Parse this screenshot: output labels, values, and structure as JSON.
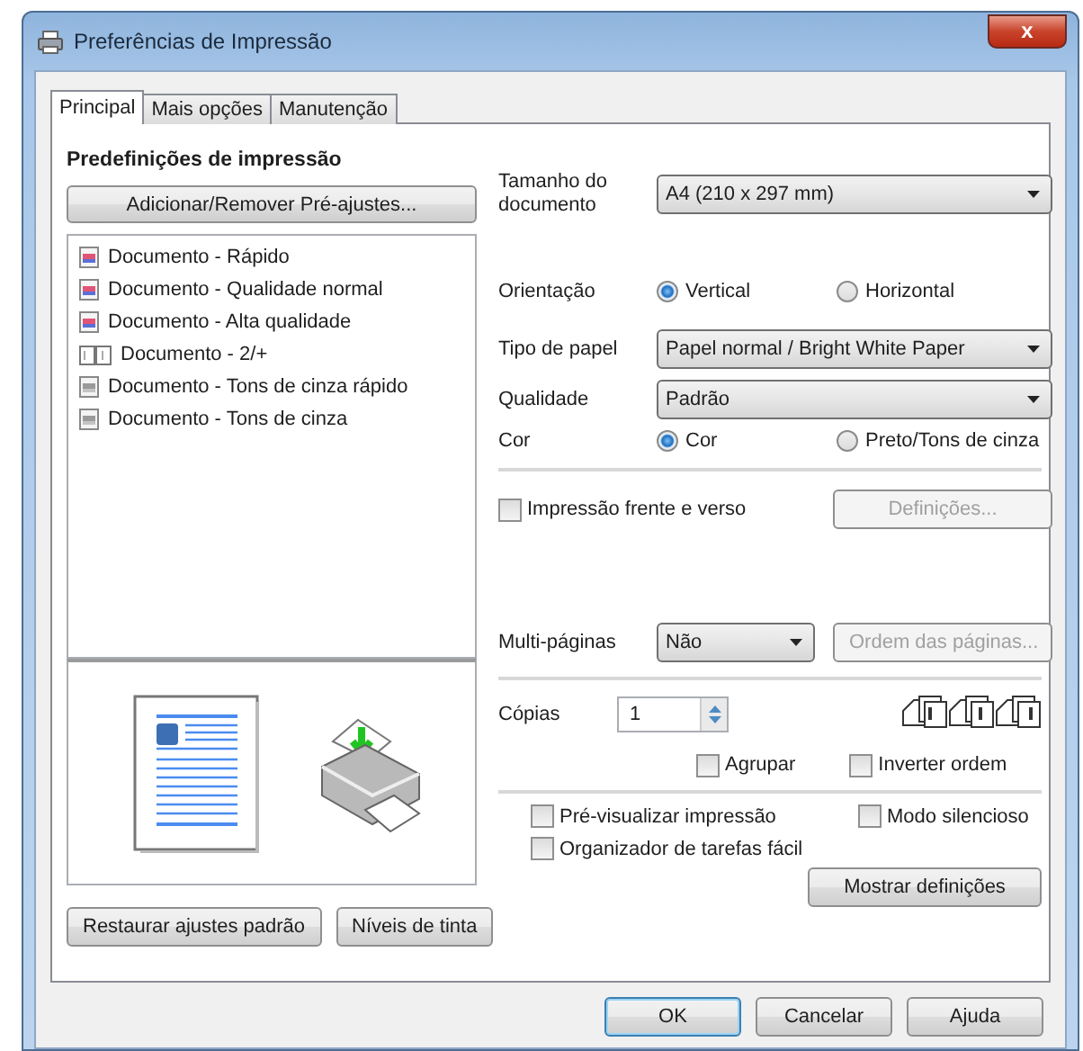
{
  "window": {
    "title": "Preferências de Impressão",
    "close": "x"
  },
  "tabs": [
    {
      "label": "Principal",
      "selected": true
    },
    {
      "label": "Mais opções",
      "selected": false
    },
    {
      "label": "Manutenção",
      "selected": false
    }
  ],
  "presets": {
    "heading": "Predefinições de impressão",
    "add_button": "Adicionar/Remover Pré-ajustes...",
    "items": [
      {
        "label": "Documento - Rápido",
        "kind": "color"
      },
      {
        "label": "Documento - Qualidade normal",
        "kind": "color"
      },
      {
        "label": "Documento - Alta qualidade",
        "kind": "color"
      },
      {
        "label": "Documento - 2/+",
        "kind": "multi"
      },
      {
        "label": "Documento - Tons de cinza rápido",
        "kind": "gray"
      },
      {
        "label": "Documento - Tons de cinza",
        "kind": "gray"
      }
    ]
  },
  "left_buttons": [
    "Restaurar ajustes padrão",
    "Níveis de tinta"
  ],
  "document_size": {
    "label": "Tamanho do documento",
    "value": "A4 (210 x 297 mm)"
  },
  "orientation": {
    "label": "Orientação",
    "options": [
      {
        "label": "Vertical",
        "selected": true
      },
      {
        "label": "Horizontal",
        "selected": false
      }
    ]
  },
  "paper_type": {
    "label": "Tipo de papel",
    "value": "Papel normal / Bright White Paper"
  },
  "quality": {
    "label": "Qualidade",
    "value": "Padrão"
  },
  "color": {
    "label": "Cor",
    "options": [
      {
        "label": "Cor",
        "selected": true
      },
      {
        "label": "Preto/Tons de cinza",
        "selected": false
      }
    ]
  },
  "duplex": {
    "label": "Impressão frente e verso",
    "checked": false,
    "button": "Definições...",
    "button_disabled": true
  },
  "multipage": {
    "label": "Multi-páginas",
    "value": "Não",
    "button": "Ordem das páginas...",
    "button_disabled": true
  },
  "copies": {
    "label": "Cópias",
    "value": "1"
  },
  "collate": {
    "label": "Agrupar",
    "checked": false
  },
  "reverse": {
    "label": "Inverter ordem",
    "checked": false
  },
  "options": [
    {
      "label": "Pré-visualizar impressão",
      "checked": false
    },
    {
      "label": "Modo silencioso",
      "checked": false
    },
    {
      "label": "Organizador de tarefas fácil",
      "checked": false
    }
  ],
  "show_settings": "Mostrar definições",
  "dialog_buttons": [
    {
      "label": "OK",
      "default": true
    },
    {
      "label": "Cancelar",
      "default": false
    },
    {
      "label": "Ajuda",
      "default": false
    }
  ]
}
